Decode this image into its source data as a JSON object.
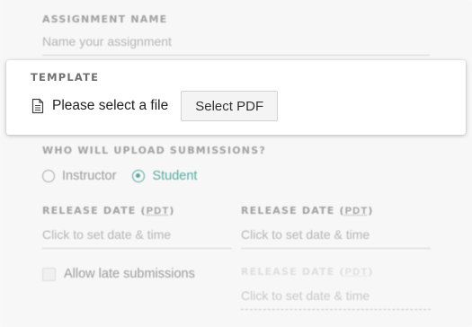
{
  "assignment_name": {
    "label": "ASSIGNMENT NAME",
    "placeholder": "Name your assignment"
  },
  "template": {
    "label": "TEMPLATE",
    "file_text": "Please select a file",
    "select_button": "Select PDF",
    "icon": "document-icon"
  },
  "upload": {
    "label": "WHO WILL UPLOAD SUBMISSIONS?",
    "options": [
      {
        "label": "Instructor",
        "selected": false
      },
      {
        "label": "Student",
        "selected": true
      }
    ]
  },
  "release_date": {
    "label_prefix": "RELEASE DATE (",
    "label_tz": "PDT",
    "label_suffix": ")",
    "placeholder": "Click to set date & time"
  },
  "due_date": {
    "label_prefix": "RELEASE DATE (",
    "label_tz": "PDT",
    "label_suffix": ")",
    "placeholder": "Click to set date & time"
  },
  "late_release_date": {
    "label_prefix": "RELEASE DATE (",
    "label_tz": "PDT",
    "label_suffix": ")",
    "placeholder": "Click to set date & time"
  },
  "late_submissions": {
    "label": "Allow late submissions",
    "checked": false
  },
  "colors": {
    "accent": "#5aa79e",
    "label": "#a0a0a0"
  }
}
